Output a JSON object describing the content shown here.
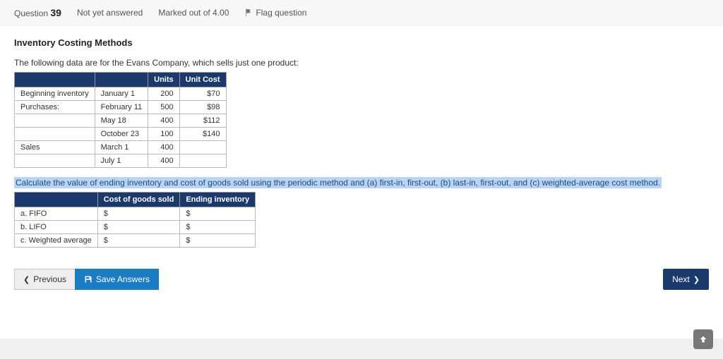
{
  "header": {
    "question_label": "Question",
    "question_number": "39",
    "status": "Not yet answered",
    "marks": "Marked out of 4.00",
    "flag": "Flag question"
  },
  "question": {
    "title": "Inventory Costing Methods",
    "intro": "The following data are for the Evans Company, which sells just one product:"
  },
  "inv_table": {
    "headers": {
      "h_units": "Units",
      "h_unitcost": "Unit Cost"
    },
    "rows": [
      {
        "c0": "Beginning inventory",
        "c1": "January 1",
        "units": "200",
        "cost": "$70"
      },
      {
        "c0": "Purchases:",
        "c1": "February 11",
        "units": "500",
        "cost": "$98"
      },
      {
        "c0": "",
        "c1": "May 18",
        "units": "400",
        "cost": "$112"
      },
      {
        "c0": "",
        "c1": "October 23",
        "units": "100",
        "cost": "$140"
      },
      {
        "c0": "Sales",
        "c1": "March 1",
        "units": "400",
        "cost": ""
      },
      {
        "c0": "",
        "c1": "July 1",
        "units": "400",
        "cost": ""
      }
    ]
  },
  "instruction": "Calculate the value of ending inventory and cost of goods sold using the periodic method and (a) first-in, first-out, (b) last-in, first-out, and (c) weighted-average cost method.",
  "ans_table": {
    "headers": {
      "h_cogs": "Cost of goods sold",
      "h_ei": "Ending inventory"
    },
    "rows": [
      {
        "label": "a. FIFO",
        "cogs": "$",
        "ei": "$"
      },
      {
        "label": "b. LIFO",
        "cogs": "$",
        "ei": "$"
      },
      {
        "label": "c. Weighted average",
        "cogs": "$",
        "ei": "$"
      }
    ]
  },
  "nav": {
    "previous": "Previous",
    "save": "Save Answers",
    "next": "Next"
  },
  "chart_data": {
    "type": "table",
    "title": "Inventory Costing Methods — Evans Company",
    "data_table": {
      "columns": [
        "",
        "",
        "Units",
        "Unit Cost"
      ],
      "rows": [
        [
          "Beginning inventory",
          "January 1",
          200,
          70
        ],
        [
          "Purchases:",
          "February 11",
          500,
          98
        ],
        [
          "",
          "May 18",
          400,
          112
        ],
        [
          "",
          "October 23",
          100,
          140
        ],
        [
          "Sales",
          "March 1",
          400,
          null
        ],
        [
          "",
          "July 1",
          400,
          null
        ]
      ]
    },
    "answer_template": {
      "columns": [
        "",
        "Cost of goods sold",
        "Ending inventory"
      ],
      "rows": [
        [
          "a. FIFO",
          null,
          null
        ],
        [
          "b. LIFO",
          null,
          null
        ],
        [
          "c. Weighted average",
          null,
          null
        ]
      ]
    }
  }
}
